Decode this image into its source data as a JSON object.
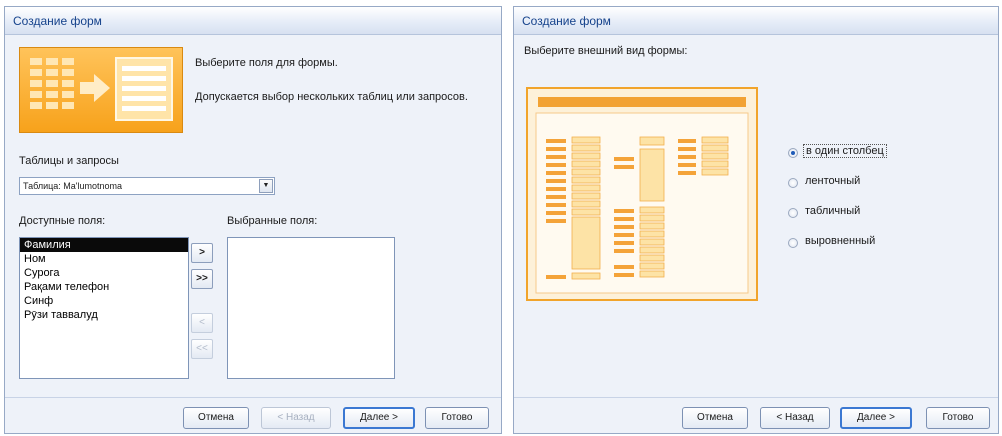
{
  "left_dialog": {
    "title": "Создание форм",
    "prompt": "Выберите поля для формы.",
    "note": "Допускается выбор нескольких таблиц или запросов.",
    "tables_label": "Таблицы и запросы",
    "table_select": {
      "value": "Таблица: Ma'lumotnoma",
      "dropdown_icon": "triangle-down"
    },
    "available_label": "Доступные поля:",
    "available_fields": [
      "Фамилия",
      "Ном",
      "Сурога",
      "Рақами телефон",
      "Синф",
      "Рӯзи таввалуд"
    ],
    "selected_field_index": 0,
    "selected_label": "Выбранные поля:",
    "selected_fields": [],
    "move_buttons": [
      ">",
      ">>",
      "<",
      "<<"
    ],
    "buttons": {
      "cancel": "Отмена",
      "back": "< Назад",
      "next": "Далее >",
      "finish": "Готово"
    }
  },
  "right_dialog": {
    "title": "Создание форм",
    "prompt": "Выберите внешний вид формы:",
    "layout_options": [
      "в один столбец",
      "ленточный",
      "табличный",
      "выровненный"
    ],
    "selected_option_index": 0,
    "buttons": {
      "cancel": "Отмена",
      "back": "< Назад",
      "next": "Далее >",
      "finish": "Готово"
    }
  },
  "colors": {
    "accent_orange": "#f7a21b",
    "title_text": "#15428b",
    "window_bg": "#eef2f9"
  }
}
